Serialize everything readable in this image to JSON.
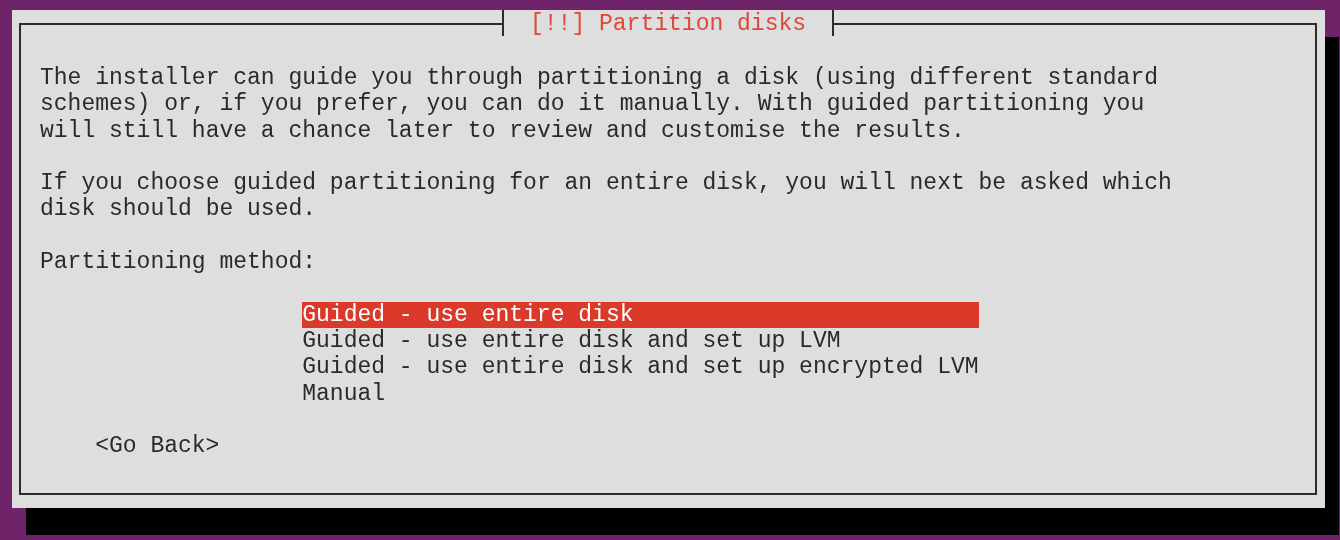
{
  "dialog": {
    "title": "[!!] Partition disks",
    "paragraphs": [
      "The installer can guide you through partitioning a disk (using different standard schemes) or, if you prefer, you can do it manually. With guided partitioning you will still have a chance later to review and customise the results.",
      "If you choose guided partitioning for an entire disk, you will next be asked which disk should be used."
    ],
    "prompt": "Partitioning method:",
    "options": [
      {
        "label": "Guided - use entire disk",
        "selected": true
      },
      {
        "label": "Guided - use entire disk and set up LVM",
        "selected": false
      },
      {
        "label": "Guided - use entire disk and set up encrypted LVM",
        "selected": false
      },
      {
        "label": "Manual",
        "selected": false
      }
    ],
    "buttons": [
      "<Go Back>"
    ]
  }
}
